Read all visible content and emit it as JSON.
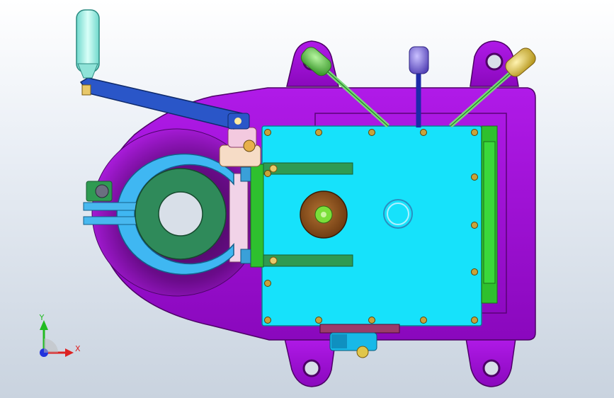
{
  "viewport": {
    "background_top": "#ffffff",
    "background_bottom": "#c9d3df"
  },
  "triad": {
    "y_label": "Y",
    "x_label": "X",
    "y_color": "#22bb22",
    "x_color": "#dd2222",
    "z_color": "#2233dd"
  },
  "colors": {
    "housing": "#a00ad8",
    "housing_dark": "#6a058f",
    "cover_plate": "#16e2fb",
    "green_parts": "#2ec02e",
    "handle_grip": "#9df0e6",
    "crank_arm": "#2a56c8",
    "clamp_ring": "#3fb7f2",
    "clamp_core": "#2f8a5a",
    "brown_knob": "#8b4b19",
    "yellow_knob": "#e0c64a",
    "violet_knob": "#7a6ad8"
  }
}
